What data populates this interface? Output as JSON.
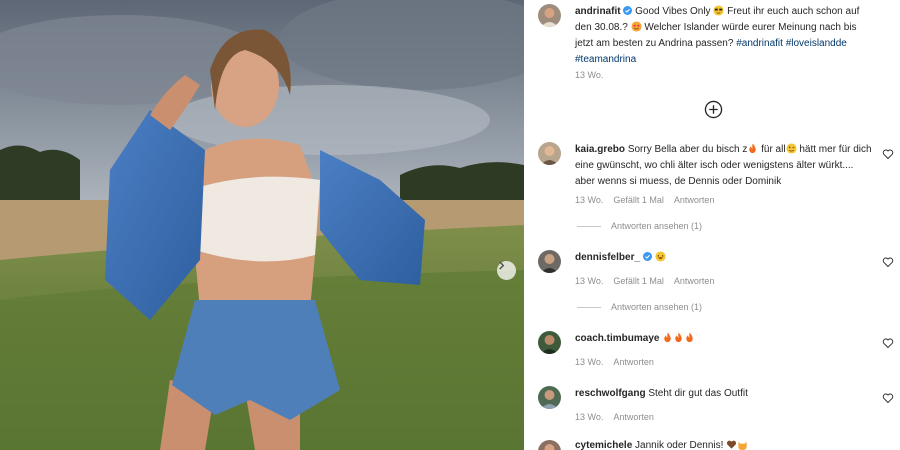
{
  "post": {
    "image_alt": "Photo of a woman in a denim jacket and white top standing in a field",
    "next_icon": "chevron-right-icon"
  },
  "caption": {
    "username": "andrinafit",
    "text_a": " Good Vibes Only ",
    "text_b": " Freut ihr euch auch schon auf den 30.08.? ",
    "text_c": " Welcher Islander würde eurer Meinung nach bis jetzt am besten zu Andrina passen? ",
    "tags": [
      "#andrinafit",
      "#loveislandde",
      "#teamandrina"
    ],
    "time": "13 Wo."
  },
  "load_more_icon": "plus-circle-icon",
  "comments": [
    {
      "username": "kaia.grebo",
      "text_a": "Sorry Bella aber du bisch z",
      "text_b": " für all",
      "text_c": " hätt mer für dich eine gwünscht, wo chli älter isch oder wenigstens älter würkt.... aber wenns si muess, de Dennis oder Dominik",
      "time": "13 Wo.",
      "likes": "Gefällt 1 Mal",
      "reply": "Antworten",
      "view_replies": "Antworten ansehen (1)"
    },
    {
      "username": "dennisfelber_",
      "verified": true,
      "time": "13 Wo.",
      "likes": "Gefällt 1 Mal",
      "reply": "Antworten",
      "view_replies": "Antworten ansehen (1)"
    },
    {
      "username": "coach.timbumaye",
      "time": "13 Wo.",
      "reply": "Antworten"
    },
    {
      "username": "reschwolfgang",
      "text": "Steht dir gut das Outfit",
      "time": "13 Wo.",
      "reply": "Antworten"
    },
    {
      "username": "cytemichele",
      "text": "Jannik oder Dennis!"
    }
  ],
  "colors": {
    "verified": "#3897f0",
    "hashtag": "#00376b",
    "meta": "#8e8e8e"
  }
}
